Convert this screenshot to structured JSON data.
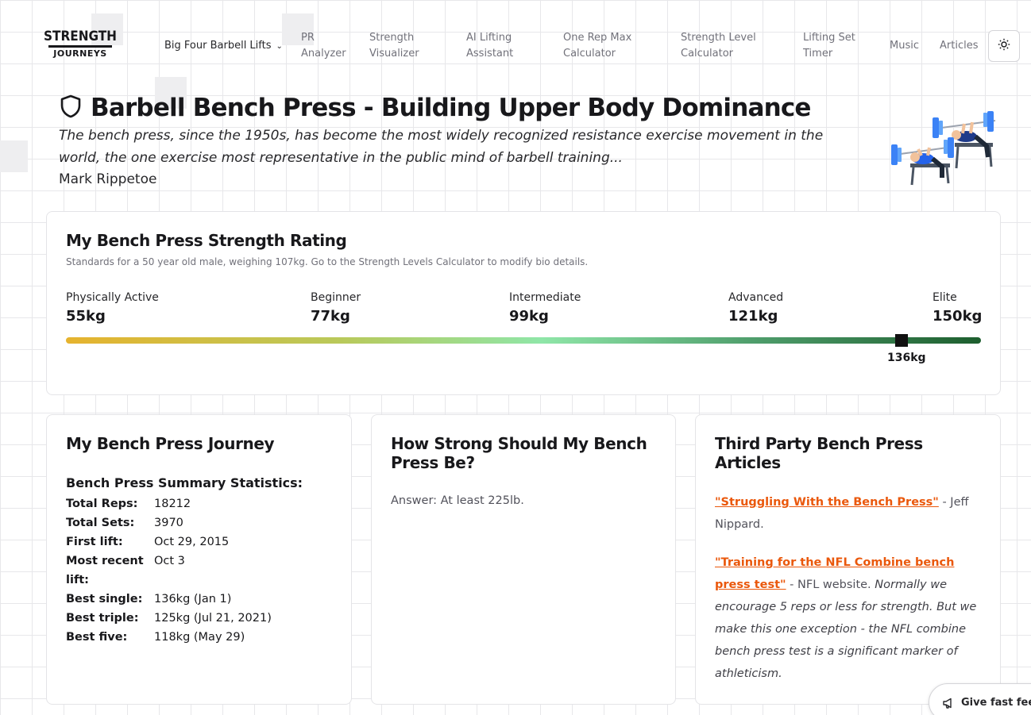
{
  "header": {
    "logo_top": "STRENGTH",
    "logo_bottom": "JOURNEYS",
    "nav": [
      {
        "label": "Big Four Barbell Lifts"
      },
      {
        "label": "PR Analyzer"
      },
      {
        "label": "Strength Visualizer"
      },
      {
        "label": "AI Lifting Assistant"
      },
      {
        "label": "One Rep Max Calculator"
      },
      {
        "label": "Strength Level Calculator"
      },
      {
        "label": "Lifting Set Timer"
      },
      {
        "label": "Music"
      },
      {
        "label": "Articles"
      }
    ],
    "theme_icon": "sun-icon"
  },
  "hero": {
    "title": "Barbell Bench Press - Building Upper Body Dominance",
    "quote": "The bench press, since the 1950s, has become the most widely recognized resistance exercise movement in the world, the one exercise most representative in the public mind of barbell training...",
    "author": "Mark Rippetoe"
  },
  "rating": {
    "title": "My Bench Press Strength Rating",
    "subtitle": "Standards for a 50 year old male, weighing 107kg. Go to the Strength Levels Calculator to modify bio details.",
    "levels": [
      {
        "name": "Physically Active",
        "value": "55kg"
      },
      {
        "name": "Beginner",
        "value": "77kg"
      },
      {
        "name": "Intermediate",
        "value": "99kg"
      },
      {
        "name": "Advanced",
        "value": "121kg"
      },
      {
        "name": "Elite",
        "value": "150kg"
      }
    ],
    "current": "136kg",
    "colors": {
      "start": "#e6b32e",
      "middle": "#8fe6a8",
      "end": "#1d5e2e"
    }
  },
  "journey": {
    "title": "My Bench Press Journey",
    "stats_title": "Bench Press Summary Statistics:",
    "stats": [
      {
        "k": "Total Reps:",
        "v": "18212"
      },
      {
        "k": "Total Sets:",
        "v": "3970"
      },
      {
        "k": "First lift:",
        "v": "Oct 29, 2015"
      },
      {
        "k": "Most recent lift:",
        "v": "Oct 3"
      },
      {
        "k": "Best single:",
        "v": "136kg (Jan 1)"
      },
      {
        "k": "Best triple:",
        "v": "125kg (Jul 21, 2021)"
      },
      {
        "k": "Best five:",
        "v": "118kg (May 29)"
      }
    ]
  },
  "howstrong": {
    "title": "How Strong Should My Bench Press Be?",
    "answer": "Answer: At least 225lb."
  },
  "third": {
    "title": "Third Party Bench Press Articles",
    "a1_link": "\"Struggling With the Bench Press\"",
    "a1_rest": " - Jeff Nippard.",
    "a2_link": "\"Training for the NFL Combine bench press test\"",
    "a2_rest": " - NFL website. ",
    "a2_note": "Normally we encourage 5 reps or less for strength. But we make this one exception - the NFL combine bench press test is a significant marker of athleticism."
  },
  "feedback": {
    "label": "Give fast feedback"
  }
}
